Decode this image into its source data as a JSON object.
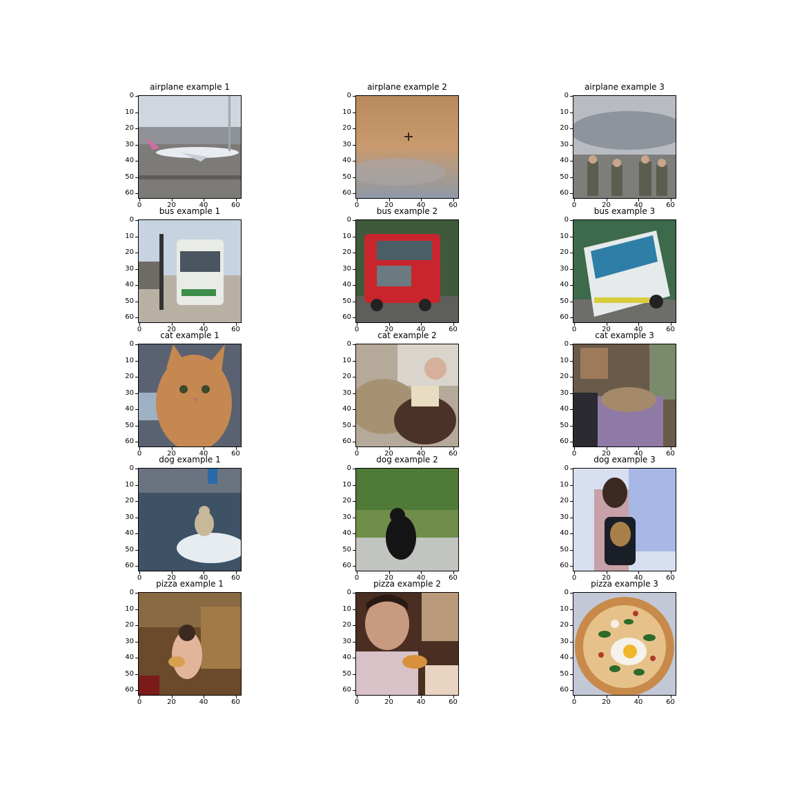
{
  "figure": {
    "panels": [
      {
        "title": "airplane example 1",
        "scene": "airplane at airport tarmac"
      },
      {
        "title": "airplane example 2",
        "scene": "small plane in orange hazy sky"
      },
      {
        "title": "airplane example 3",
        "scene": "soldiers saluting in front of cargo plane"
      },
      {
        "title": "bus example 1",
        "scene": "white city bus at curb"
      },
      {
        "title": "bus example 2",
        "scene": "red double-decker bus"
      },
      {
        "title": "bus example 3",
        "scene": "white and blue coach bus"
      },
      {
        "title": "cat example 1",
        "scene": "orange tabby cat near keyboard"
      },
      {
        "title": "cat example 2",
        "scene": "man with cat on couch"
      },
      {
        "title": "cat example 3",
        "scene": "cat sleeping on purple cloth"
      },
      {
        "title": "dog example 1",
        "scene": "dog on small boat in water"
      },
      {
        "title": "dog example 2",
        "scene": "black dog sitting on grass"
      },
      {
        "title": "dog example 3",
        "scene": "dog in backpack carried by person"
      },
      {
        "title": "pizza example 1",
        "scene": "child eating pizza slice"
      },
      {
        "title": "pizza example 2",
        "scene": "person holding pizza slice"
      },
      {
        "title": "pizza example 3",
        "scene": "pizza with eggs and basil"
      }
    ],
    "xticks": [
      "0",
      "20",
      "40",
      "60"
    ],
    "yticks": [
      "0",
      "10",
      "20",
      "30",
      "40",
      "50",
      "60"
    ]
  }
}
